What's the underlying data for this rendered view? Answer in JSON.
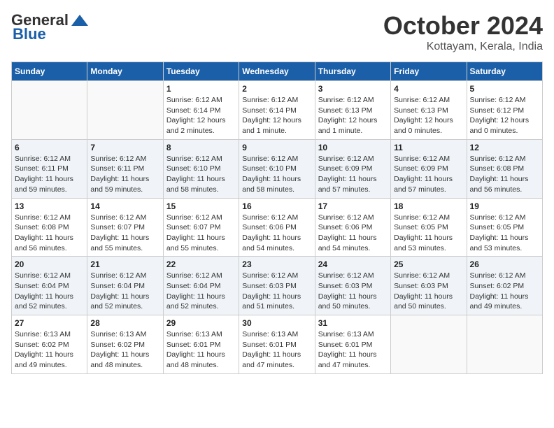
{
  "header": {
    "logo_general": "General",
    "logo_blue": "Blue",
    "month": "October 2024",
    "location": "Kottayam, Kerala, India"
  },
  "days_of_week": [
    "Sunday",
    "Monday",
    "Tuesday",
    "Wednesday",
    "Thursday",
    "Friday",
    "Saturday"
  ],
  "weeks": [
    [
      {
        "day": "",
        "sunrise": "",
        "sunset": "",
        "daylight": ""
      },
      {
        "day": "",
        "sunrise": "",
        "sunset": "",
        "daylight": ""
      },
      {
        "day": "1",
        "sunrise": "Sunrise: 6:12 AM",
        "sunset": "Sunset: 6:14 PM",
        "daylight": "Daylight: 12 hours and 2 minutes."
      },
      {
        "day": "2",
        "sunrise": "Sunrise: 6:12 AM",
        "sunset": "Sunset: 6:14 PM",
        "daylight": "Daylight: 12 hours and 1 minute."
      },
      {
        "day": "3",
        "sunrise": "Sunrise: 6:12 AM",
        "sunset": "Sunset: 6:13 PM",
        "daylight": "Daylight: 12 hours and 1 minute."
      },
      {
        "day": "4",
        "sunrise": "Sunrise: 6:12 AM",
        "sunset": "Sunset: 6:13 PM",
        "daylight": "Daylight: 12 hours and 0 minutes."
      },
      {
        "day": "5",
        "sunrise": "Sunrise: 6:12 AM",
        "sunset": "Sunset: 6:12 PM",
        "daylight": "Daylight: 12 hours and 0 minutes."
      }
    ],
    [
      {
        "day": "6",
        "sunrise": "Sunrise: 6:12 AM",
        "sunset": "Sunset: 6:11 PM",
        "daylight": "Daylight: 11 hours and 59 minutes."
      },
      {
        "day": "7",
        "sunrise": "Sunrise: 6:12 AM",
        "sunset": "Sunset: 6:11 PM",
        "daylight": "Daylight: 11 hours and 59 minutes."
      },
      {
        "day": "8",
        "sunrise": "Sunrise: 6:12 AM",
        "sunset": "Sunset: 6:10 PM",
        "daylight": "Daylight: 11 hours and 58 minutes."
      },
      {
        "day": "9",
        "sunrise": "Sunrise: 6:12 AM",
        "sunset": "Sunset: 6:10 PM",
        "daylight": "Daylight: 11 hours and 58 minutes."
      },
      {
        "day": "10",
        "sunrise": "Sunrise: 6:12 AM",
        "sunset": "Sunset: 6:09 PM",
        "daylight": "Daylight: 11 hours and 57 minutes."
      },
      {
        "day": "11",
        "sunrise": "Sunrise: 6:12 AM",
        "sunset": "Sunset: 6:09 PM",
        "daylight": "Daylight: 11 hours and 57 minutes."
      },
      {
        "day": "12",
        "sunrise": "Sunrise: 6:12 AM",
        "sunset": "Sunset: 6:08 PM",
        "daylight": "Daylight: 11 hours and 56 minutes."
      }
    ],
    [
      {
        "day": "13",
        "sunrise": "Sunrise: 6:12 AM",
        "sunset": "Sunset: 6:08 PM",
        "daylight": "Daylight: 11 hours and 56 minutes."
      },
      {
        "day": "14",
        "sunrise": "Sunrise: 6:12 AM",
        "sunset": "Sunset: 6:07 PM",
        "daylight": "Daylight: 11 hours and 55 minutes."
      },
      {
        "day": "15",
        "sunrise": "Sunrise: 6:12 AM",
        "sunset": "Sunset: 6:07 PM",
        "daylight": "Daylight: 11 hours and 55 minutes."
      },
      {
        "day": "16",
        "sunrise": "Sunrise: 6:12 AM",
        "sunset": "Sunset: 6:06 PM",
        "daylight": "Daylight: 11 hours and 54 minutes."
      },
      {
        "day": "17",
        "sunrise": "Sunrise: 6:12 AM",
        "sunset": "Sunset: 6:06 PM",
        "daylight": "Daylight: 11 hours and 54 minutes."
      },
      {
        "day": "18",
        "sunrise": "Sunrise: 6:12 AM",
        "sunset": "Sunset: 6:05 PM",
        "daylight": "Daylight: 11 hours and 53 minutes."
      },
      {
        "day": "19",
        "sunrise": "Sunrise: 6:12 AM",
        "sunset": "Sunset: 6:05 PM",
        "daylight": "Daylight: 11 hours and 53 minutes."
      }
    ],
    [
      {
        "day": "20",
        "sunrise": "Sunrise: 6:12 AM",
        "sunset": "Sunset: 6:04 PM",
        "daylight": "Daylight: 11 hours and 52 minutes."
      },
      {
        "day": "21",
        "sunrise": "Sunrise: 6:12 AM",
        "sunset": "Sunset: 6:04 PM",
        "daylight": "Daylight: 11 hours and 52 minutes."
      },
      {
        "day": "22",
        "sunrise": "Sunrise: 6:12 AM",
        "sunset": "Sunset: 6:04 PM",
        "daylight": "Daylight: 11 hours and 52 minutes."
      },
      {
        "day": "23",
        "sunrise": "Sunrise: 6:12 AM",
        "sunset": "Sunset: 6:03 PM",
        "daylight": "Daylight: 11 hours and 51 minutes."
      },
      {
        "day": "24",
        "sunrise": "Sunrise: 6:12 AM",
        "sunset": "Sunset: 6:03 PM",
        "daylight": "Daylight: 11 hours and 50 minutes."
      },
      {
        "day": "25",
        "sunrise": "Sunrise: 6:12 AM",
        "sunset": "Sunset: 6:03 PM",
        "daylight": "Daylight: 11 hours and 50 minutes."
      },
      {
        "day": "26",
        "sunrise": "Sunrise: 6:12 AM",
        "sunset": "Sunset: 6:02 PM",
        "daylight": "Daylight: 11 hours and 49 minutes."
      }
    ],
    [
      {
        "day": "27",
        "sunrise": "Sunrise: 6:13 AM",
        "sunset": "Sunset: 6:02 PM",
        "daylight": "Daylight: 11 hours and 49 minutes."
      },
      {
        "day": "28",
        "sunrise": "Sunrise: 6:13 AM",
        "sunset": "Sunset: 6:02 PM",
        "daylight": "Daylight: 11 hours and 48 minutes."
      },
      {
        "day": "29",
        "sunrise": "Sunrise: 6:13 AM",
        "sunset": "Sunset: 6:01 PM",
        "daylight": "Daylight: 11 hours and 48 minutes."
      },
      {
        "day": "30",
        "sunrise": "Sunrise: 6:13 AM",
        "sunset": "Sunset: 6:01 PM",
        "daylight": "Daylight: 11 hours and 47 minutes."
      },
      {
        "day": "31",
        "sunrise": "Sunrise: 6:13 AM",
        "sunset": "Sunset: 6:01 PM",
        "daylight": "Daylight: 11 hours and 47 minutes."
      },
      {
        "day": "",
        "sunrise": "",
        "sunset": "",
        "daylight": ""
      },
      {
        "day": "",
        "sunrise": "",
        "sunset": "",
        "daylight": ""
      }
    ]
  ]
}
